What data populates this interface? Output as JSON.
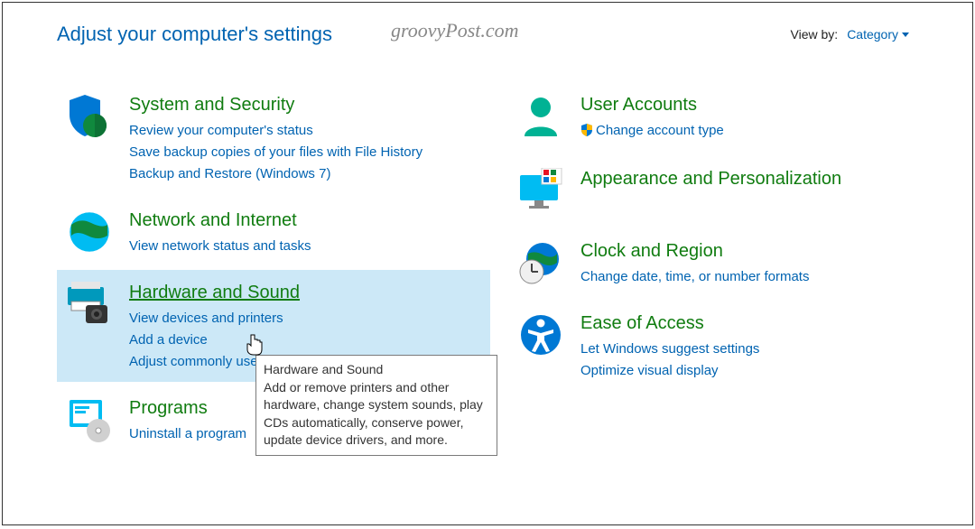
{
  "header": {
    "title": "Adjust your computer's settings",
    "watermark": "groovyPost.com",
    "viewby_label": "View by:",
    "viewby_value": "Category"
  },
  "left": [
    {
      "title": "System and Security",
      "links": [
        "Review your computer's status",
        "Save backup copies of your files with File History",
        "Backup and Restore (Windows 7)"
      ]
    },
    {
      "title": "Network and Internet",
      "links": [
        "View network status and tasks"
      ]
    },
    {
      "title": "Hardware and Sound",
      "links": [
        "View devices and printers",
        "Add a device",
        "Adjust commonly used mobility settings"
      ]
    },
    {
      "title": "Programs",
      "links": [
        "Uninstall a program"
      ]
    }
  ],
  "right": [
    {
      "title": "User Accounts",
      "links": [
        "Change account type"
      ],
      "shield": [
        true
      ]
    },
    {
      "title": "Appearance and Personalization",
      "links": []
    },
    {
      "title": "Clock and Region",
      "links": [
        "Change date, time, or number formats"
      ]
    },
    {
      "title": "Ease of Access",
      "links": [
        "Let Windows suggest settings",
        "Optimize visual display"
      ]
    }
  ],
  "tooltip": {
    "title": "Hardware and Sound",
    "body": "Add or remove printers and other hardware, change system sounds, play CDs automatically, conserve power, update device drivers, and more."
  }
}
